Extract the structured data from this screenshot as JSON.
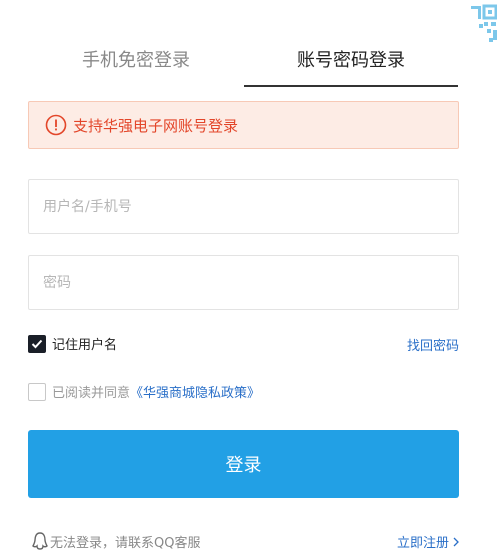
{
  "tabs": [
    {
      "label": "手机免密登录",
      "active": false
    },
    {
      "label": "账号密码登录",
      "active": true
    }
  ],
  "notice": {
    "icon": "alert-circle-icon",
    "text": "支持华强电子网账号登录",
    "color": "#e3462a"
  },
  "form": {
    "username_placeholder": "用户名/手机号",
    "username_value": "",
    "password_placeholder": "密码",
    "password_value": ""
  },
  "remember": {
    "label": "记住用户名",
    "checked": true
  },
  "forgot_label": "找回密码",
  "agreement": {
    "prefix": "已阅读并同意",
    "link": "《华强商城隐私政策》",
    "checked": false
  },
  "login_label": "登录",
  "help_label": "无法登录，请联系QQ客服",
  "register_label": "立即注册",
  "colors": {
    "accent": "#22a0e5",
    "link": "#2a6fc8",
    "alert": "#e3462a"
  }
}
